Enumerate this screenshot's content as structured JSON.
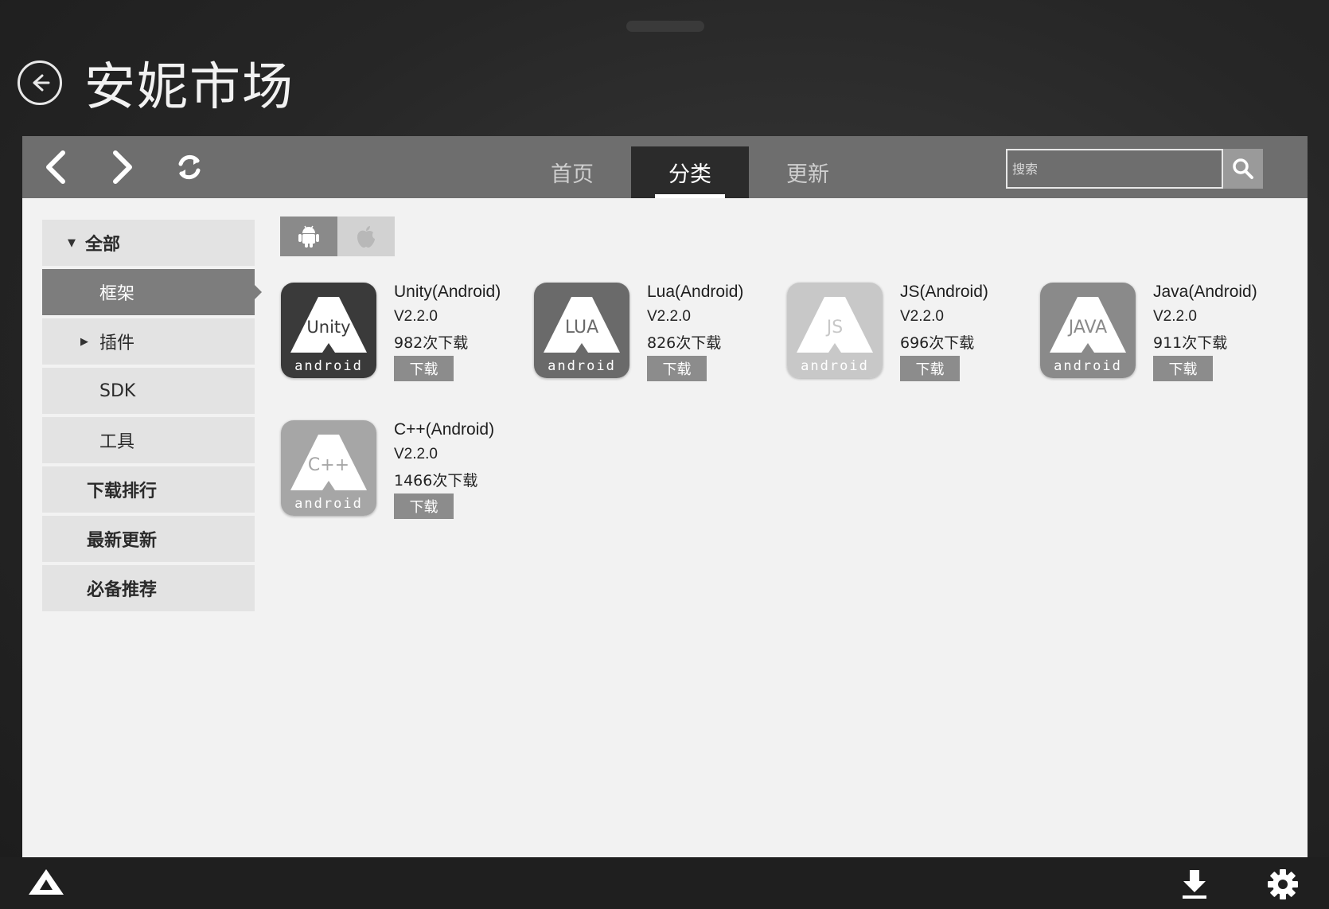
{
  "window": {
    "title": "安妮市场"
  },
  "toolbar": {
    "tabs": [
      {
        "label": "首页"
      },
      {
        "label": "分类"
      },
      {
        "label": "更新"
      }
    ],
    "search": {
      "placeholder": "搜索",
      "value": ""
    }
  },
  "sidebar": {
    "items": [
      {
        "label": "全部",
        "caret": "▼"
      },
      {
        "label": "框架"
      },
      {
        "label": "插件",
        "caret": "▶"
      },
      {
        "label": "SDK"
      },
      {
        "label": "工具"
      },
      {
        "label": "下载排行"
      },
      {
        "label": "最新更新"
      },
      {
        "label": "必备推荐"
      }
    ]
  },
  "platform_filter": {
    "options": [
      "android-icon",
      "apple-icon"
    ],
    "selected": "android-icon"
  },
  "apps": [
    {
      "name": "Unity(Android)",
      "version": "V2.2.0",
      "downloads": "982次下载",
      "button": "下载",
      "icon_label": "Unity",
      "icon_brand": "android",
      "icon_color": "#3a3a3a"
    },
    {
      "name": "Lua(Android)",
      "version": "V2.2.0",
      "downloads": "826次下载",
      "button": "下载",
      "icon_label": "LUA",
      "icon_brand": "android",
      "icon_color": "#6a6a6a"
    },
    {
      "name": "JS(Android)",
      "version": "V2.2.0",
      "downloads": "696次下载",
      "button": "下载",
      "icon_label": "JS",
      "icon_brand": "android",
      "icon_color": "#c8c8c8"
    },
    {
      "name": "Java(Android)",
      "version": "V2.2.0",
      "downloads": "911次下载",
      "button": "下载",
      "icon_label": "JAVA",
      "icon_brand": "android",
      "icon_color": "#8a8a8a"
    },
    {
      "name": "C++(Android)",
      "version": "V2.2.0",
      "downloads": "1466次下载",
      "button": "下载",
      "icon_label": "C++",
      "icon_brand": "android",
      "icon_color": "#a6a6a6"
    }
  ],
  "bottom_bar": {
    "icons": [
      "anysdk-logo-icon",
      "download-icon",
      "gear-icon"
    ]
  }
}
